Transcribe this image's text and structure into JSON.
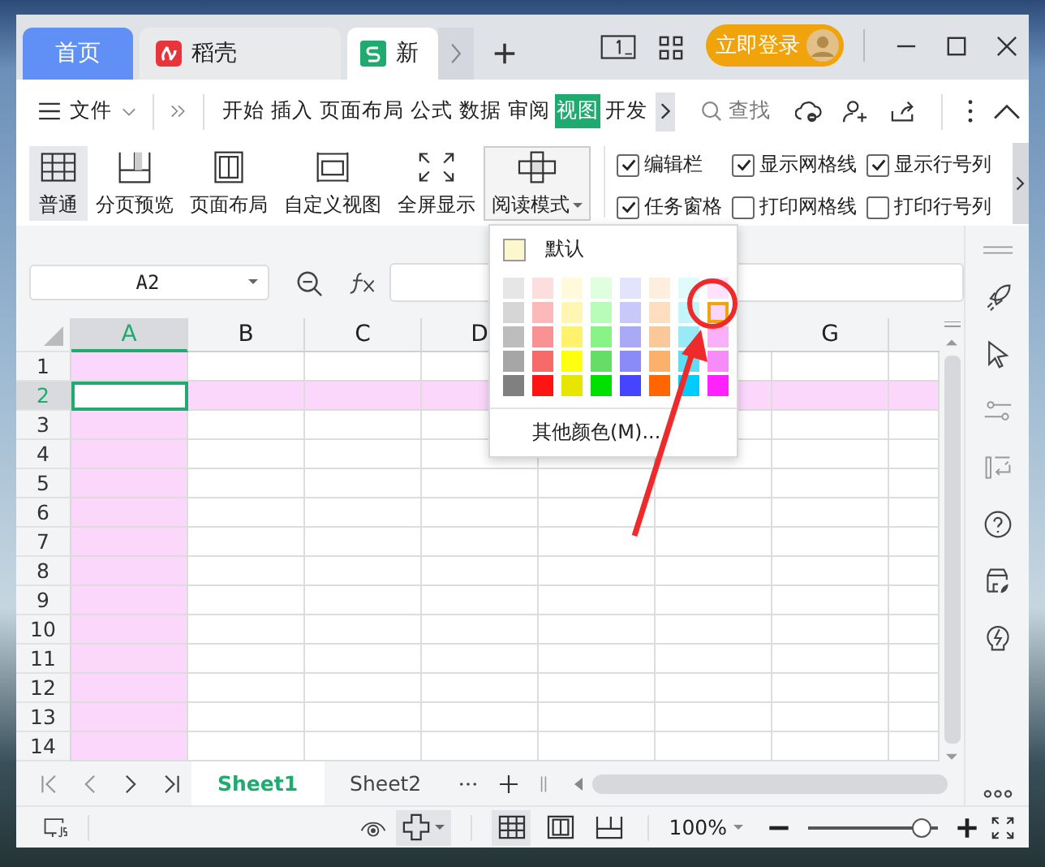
{
  "tabs": [
    {
      "label": "首页",
      "kind": "home",
      "selected": false
    },
    {
      "label": "稻壳",
      "kind": "docer",
      "selected": false
    },
    {
      "label": "新",
      "kind": "sheet",
      "selected": true
    }
  ],
  "login_button": "立即登录",
  "menu": {
    "file": "文件",
    "items": [
      {
        "label": "开始",
        "selected": false
      },
      {
        "label": "插入",
        "selected": false
      },
      {
        "label": "页面布局",
        "selected": false
      },
      {
        "label": "公式",
        "selected": false
      },
      {
        "label": "数据",
        "selected": false
      },
      {
        "label": "审阅",
        "selected": false
      },
      {
        "label": "视图",
        "selected": true
      },
      {
        "label": "开发",
        "selected": false
      }
    ],
    "search": "查找"
  },
  "ribbon": [
    {
      "label": "普通",
      "kind": "grid",
      "selected": true,
      "expanded": false
    },
    {
      "label": "分页预览",
      "kind": "pagebreak",
      "selected": false,
      "expanded": false
    },
    {
      "label": "页面布局",
      "kind": "layout",
      "selected": false,
      "expanded": false
    },
    {
      "label": "自定义视图",
      "kind": "custom",
      "selected": false,
      "expanded": false
    },
    {
      "label": "全屏显示",
      "kind": "fullscreen",
      "selected": false,
      "expanded": false
    },
    {
      "label": "阅读模式",
      "kind": "reading",
      "selected": false,
      "expanded": true
    }
  ],
  "checkboxes": [
    {
      "label": "编辑栏",
      "checked": true
    },
    {
      "label": "显示网格线",
      "checked": true
    },
    {
      "label": "显示行号列",
      "checked": true
    },
    {
      "label": "任务窗格",
      "checked": true
    },
    {
      "label": "打印网格线",
      "checked": false
    },
    {
      "label": "打印行号列",
      "checked": false
    }
  ],
  "color_menu": {
    "default_label": "默认",
    "more": "其他颜色(M)...",
    "swatches": [
      {
        "color": "#e6e6e6",
        "selected": false
      },
      {
        "color": "#fddede",
        "selected": false
      },
      {
        "color": "#fffadc",
        "selected": false
      },
      {
        "color": "#dfffdf",
        "selected": false
      },
      {
        "color": "#e3e3fb",
        "selected": false
      },
      {
        "color": "#fdeede",
        "selected": false
      },
      {
        "color": "#e1fbfd",
        "selected": false
      },
      {
        "color": "#fde3fd",
        "selected": false
      },
      {
        "color": "#d6d6d6",
        "selected": false
      },
      {
        "color": "#fbb9b9",
        "selected": false
      },
      {
        "color": "#fff6b4",
        "selected": false
      },
      {
        "color": "#b9fbb9",
        "selected": false
      },
      {
        "color": "#c8c8f9",
        "selected": false
      },
      {
        "color": "#fddec0",
        "selected": false
      },
      {
        "color": "#c3f5fb",
        "selected": false
      },
      {
        "color": "#fcd7fc",
        "selected": true
      },
      {
        "color": "#bdbdbd",
        "selected": false
      },
      {
        "color": "#f99393",
        "selected": false
      },
      {
        "color": "#fff36e",
        "selected": false
      },
      {
        "color": "#88f488",
        "selected": false
      },
      {
        "color": "#a9a9f6",
        "selected": false
      },
      {
        "color": "#fbc999",
        "selected": false
      },
      {
        "color": "#9ae9f7",
        "selected": false
      },
      {
        "color": "#f9b0f9",
        "selected": false
      },
      {
        "color": "#a6a6a6",
        "selected": false
      },
      {
        "color": "#f66a6a",
        "selected": false
      },
      {
        "color": "#ffff10",
        "selected": false
      },
      {
        "color": "#66dd66",
        "selected": false
      },
      {
        "color": "#8a8af8",
        "selected": false
      },
      {
        "color": "#fbb06b",
        "selected": false
      },
      {
        "color": "#60dcf5",
        "selected": false
      },
      {
        "color": "#f78bf7",
        "selected": false
      },
      {
        "color": "#808080",
        "selected": false
      },
      {
        "color": "#ff1414",
        "selected": false
      },
      {
        "color": "#e6e600",
        "selected": false
      },
      {
        "color": "#00e000",
        "selected": false
      },
      {
        "color": "#4545ff",
        "selected": false
      },
      {
        "color": "#ff6600",
        "selected": false
      },
      {
        "color": "#00ccff",
        "selected": false
      },
      {
        "color": "#ff22ff",
        "selected": false
      }
    ]
  },
  "name_box": "A2",
  "columns": [
    {
      "label": "A",
      "selected": true
    },
    {
      "label": "B",
      "selected": false
    },
    {
      "label": "C",
      "selected": false
    },
    {
      "label": "D",
      "selected": false
    },
    {
      "selected": false
    },
    {
      "selected": false
    },
    {
      "label": "G",
      "selected": false
    }
  ],
  "rows": [
    {
      "label": "1",
      "selected": false
    },
    {
      "label": "2",
      "selected": true
    },
    {
      "label": "3",
      "selected": false
    },
    {
      "label": "4",
      "selected": false
    },
    {
      "label": "5",
      "selected": false
    },
    {
      "label": "6",
      "selected": false
    },
    {
      "label": "7",
      "selected": false
    },
    {
      "label": "8",
      "selected": false
    },
    {
      "label": "9",
      "selected": false
    },
    {
      "label": "10",
      "selected": false
    },
    {
      "label": "11",
      "selected": false
    },
    {
      "label": "12",
      "selected": false
    },
    {
      "label": "13",
      "selected": false
    },
    {
      "label": "14",
      "selected": false
    }
  ],
  "sheets": [
    {
      "label": "Sheet1",
      "selected": true
    },
    {
      "label": "Sheet2",
      "selected": false
    }
  ],
  "status": {
    "views": [
      {
        "kind": "normal",
        "selected": true
      },
      {
        "kind": "pagebreak",
        "selected": false
      },
      {
        "kind": "layout",
        "selected": false
      }
    ],
    "zoom": "100%",
    "zoom_slider": {
      "level": 0.95
    }
  }
}
